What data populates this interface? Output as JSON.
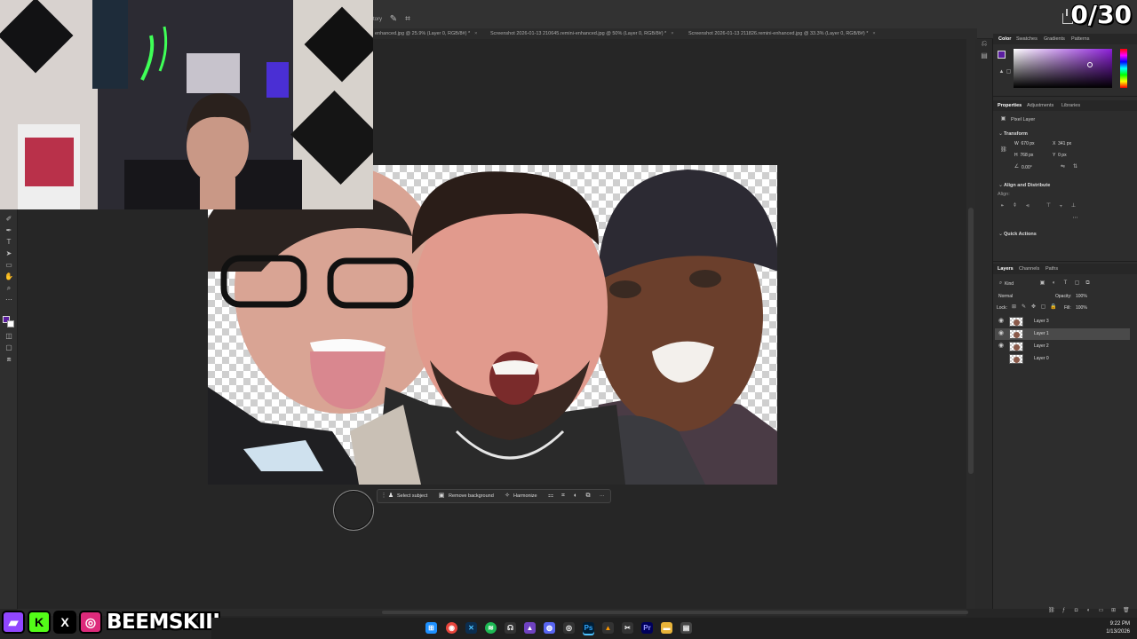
{
  "overlay": {
    "counter": "0/30",
    "handle": "BEEMSKIII",
    "socials": [
      "twitch",
      "kick",
      "x",
      "instagram"
    ]
  },
  "menubar": {
    "partial_tab": "tory"
  },
  "documents": {
    "tabs": [
      {
        "label": "enhanced.jpg @ 25.9% (Layer 0, RGB/8#) *"
      },
      {
        "label": "Screenshot 2026-01-13 210645.remini-enhanced.jpg @ 50% (Layer 0, RGB/8#) *"
      },
      {
        "label": "Screenshot 2026-01-13 211826.remini-enhanced.jpg @ 33.3% (Layer 0, RGB/8#) *"
      }
    ]
  },
  "context_bar": {
    "select_subject": "Select subject",
    "remove_background": "Remove background",
    "harmonize": "Harmonize",
    "more": "···"
  },
  "panels": {
    "color_tabs": [
      "Color",
      "Swatches",
      "Gradients",
      "Patterns"
    ],
    "properties_tabs": [
      "Properties",
      "Adjustments",
      "Libraries"
    ],
    "pixel_layer": "Pixel Layer",
    "transform": {
      "title": "Transform",
      "w_label": "W",
      "w": "670 px",
      "x_label": "X",
      "x": "341 px",
      "h_label": "H",
      "h": "768 px",
      "y_label": "Y",
      "y": "0 px",
      "angle": "0.00°"
    },
    "align": {
      "title": "Align and Distribute",
      "sub": "Align:"
    },
    "quick_actions": "Quick Actions",
    "layers_tabs": [
      "Layers",
      "Channels",
      "Paths"
    ],
    "filter": "Kind",
    "blend_mode": "Normal",
    "opacity_label": "Opacity:",
    "opacity": "100%",
    "lock_label": "Lock:",
    "fill_label": "Fill:",
    "fill": "100%",
    "layers": [
      {
        "name": "Layer 3",
        "visible": true,
        "selected": false
      },
      {
        "name": "Layer 1",
        "visible": true,
        "selected": true
      },
      {
        "name": "Layer 2",
        "visible": true,
        "selected": false
      },
      {
        "name": "Layer 0",
        "visible": false,
        "selected": false
      }
    ]
  },
  "taskbar": {
    "time": "9:22 PM",
    "date": "1/13/2026"
  },
  "colors": {
    "foreground": "#5b1ea0",
    "accent": "#8c1fd8"
  }
}
